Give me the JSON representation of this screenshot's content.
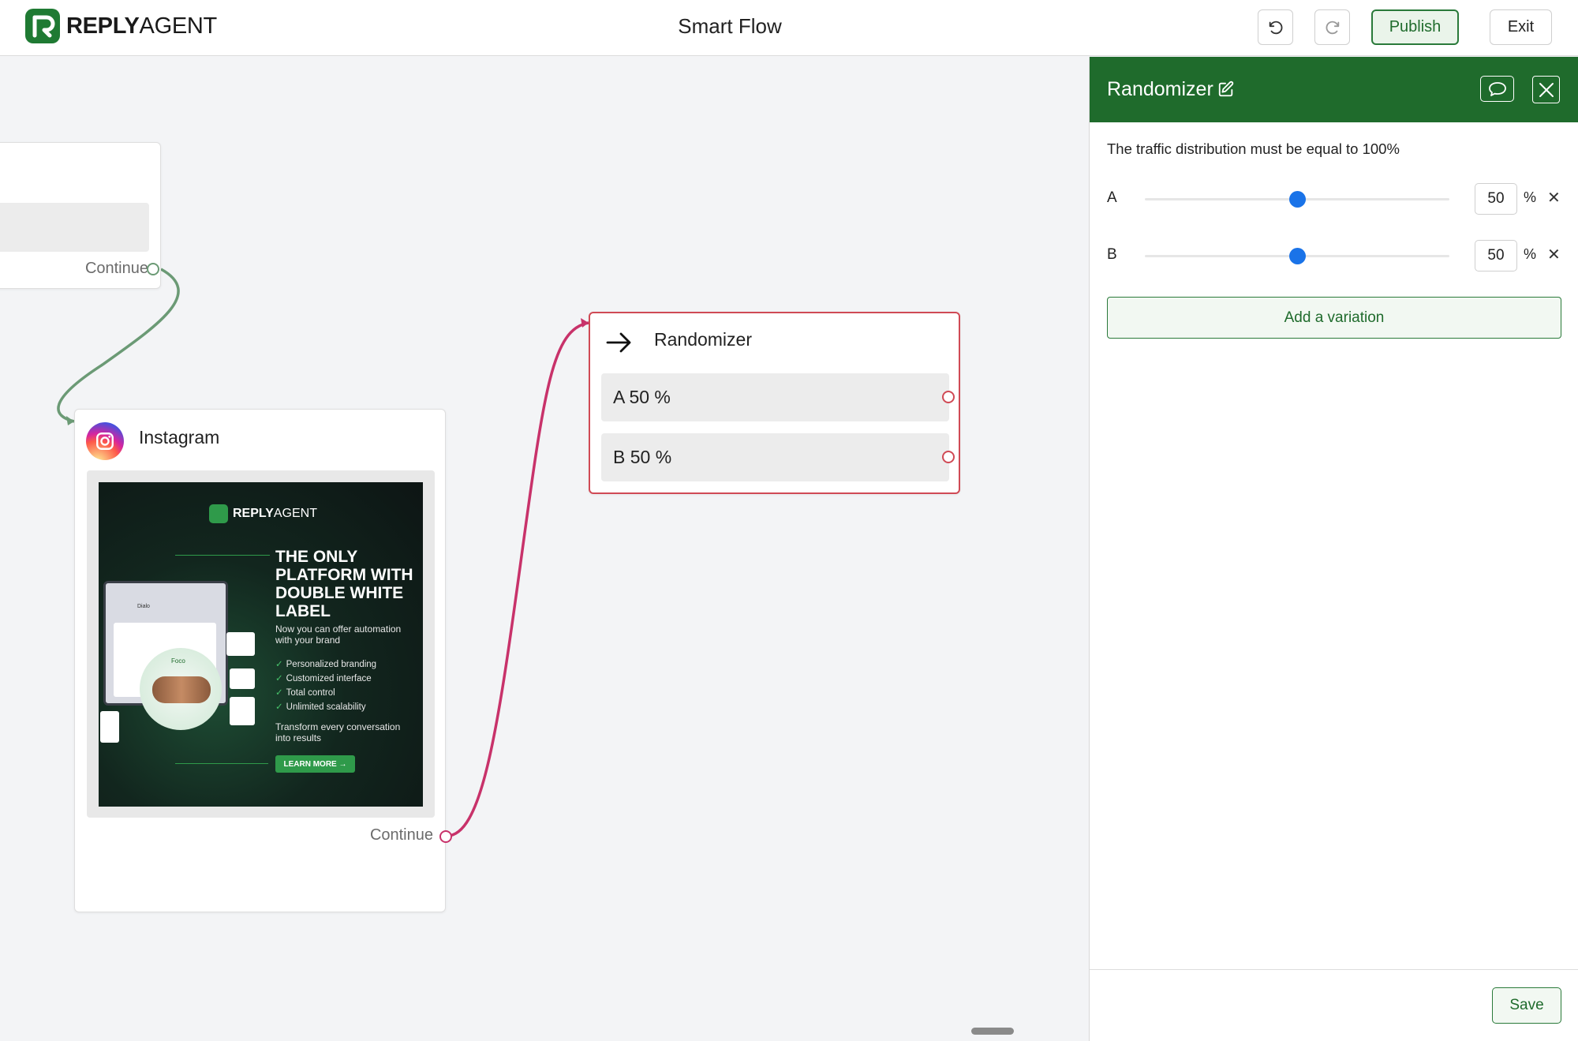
{
  "header": {
    "logo": {
      "bold": "REPLY",
      "regular": "AGENT"
    },
    "title": "Smart Flow",
    "undo_icon": "undo-icon",
    "redo_icon": "redo-icon",
    "publish_label": "Publish",
    "exit_label": "Exit"
  },
  "canvas": {
    "partial_node": {
      "continue_label": "Continue"
    },
    "instagram_node": {
      "icon": "instagram-icon",
      "title": "Instagram",
      "continue_label": "Continue",
      "ad": {
        "logo": {
          "bold": "REPLY",
          "regular": "AGENT"
        },
        "headline": "THE ONLY PLATFORM WITH DOUBLE WHITE LABEL",
        "subheadline": "Now you can offer automation with your brand",
        "features": [
          "Personalized branding",
          "Customized interface",
          "Total control",
          "Unlimited scalability"
        ],
        "tagline": "Transform every conversation into results",
        "cta": "LEARN MORE →",
        "mock_labels": {
          "dialog_title": "Dialo",
          "circle_label": "Foco"
        }
      }
    },
    "randomizer_node": {
      "icon": "arrow-right-icon",
      "title": "Randomizer",
      "variations": [
        {
          "label": "A 50 %"
        },
        {
          "label": "B 50 %"
        }
      ]
    }
  },
  "panel": {
    "title": "Randomizer",
    "edit_icon": "edit-icon",
    "comment_icon": "comment-icon",
    "close_icon": "close-icon",
    "note": "The traffic distribution must be equal to 100%",
    "variations": [
      {
        "name": "A",
        "value": "50",
        "unit": "%",
        "remove": "✕",
        "level": 0.5
      },
      {
        "name": "B",
        "value": "50",
        "unit": "%",
        "remove": "✕",
        "level": 0.5
      }
    ],
    "add_variation_label": "Add a variation",
    "save_label": "Save"
  },
  "colors": {
    "brand_green": "#1f6b2c",
    "connector_green": "#6b9a75",
    "connector_pink": "#c8326a",
    "randomizer_border": "#d04a55",
    "slider_thumb": "#1a73e8"
  }
}
